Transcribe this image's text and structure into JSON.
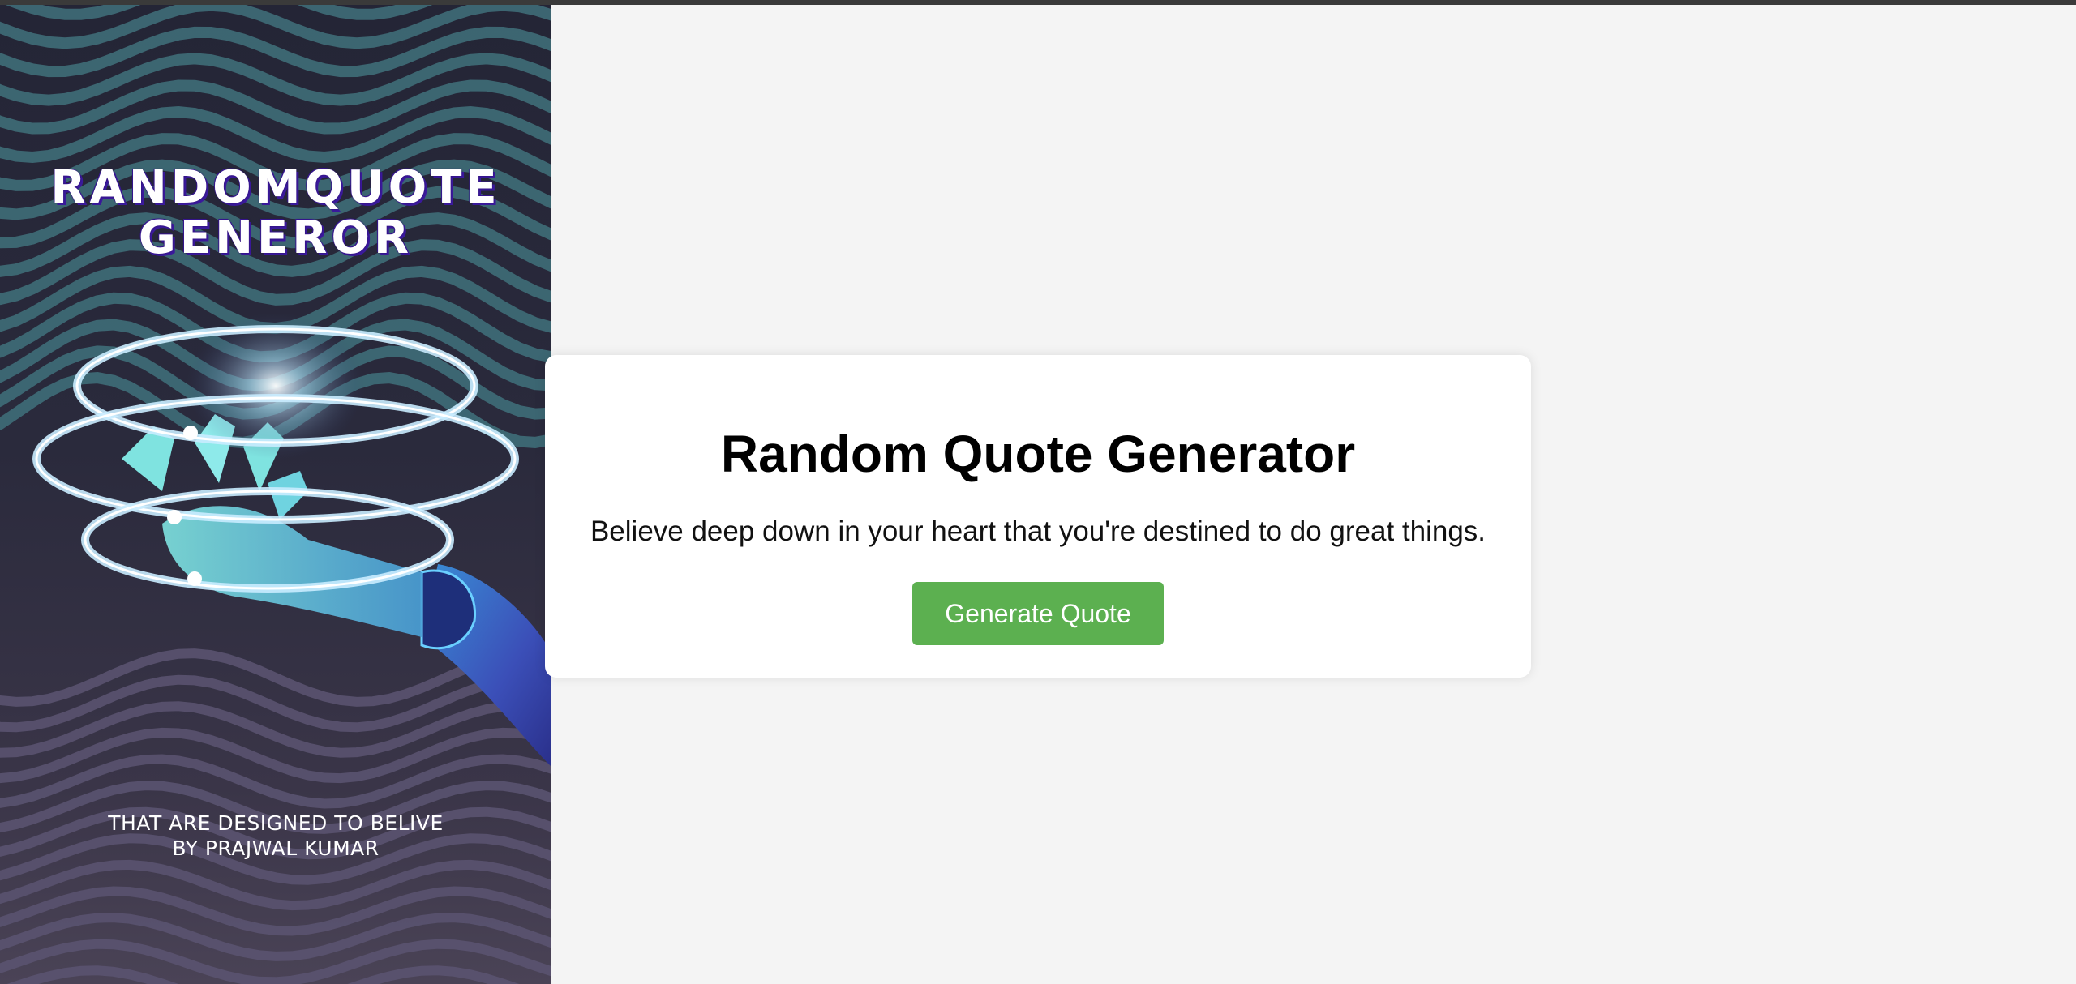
{
  "poster": {
    "title_line1": "RANDOMQUOTE",
    "title_line2": "GENEROR",
    "subtitle_line1": "THAT ARE DESIGNED TO BELIVE",
    "subtitle_line2": "BY PRAJWAL KUMAR",
    "image_subject": "robot-hand-with-glowing-rings"
  },
  "card": {
    "heading": "Random Quote Generator",
    "quote": "Believe deep down in your heart that you're destined to do great things.",
    "button_label": "Generate Quote"
  },
  "colors": {
    "page_background": "#f4f4f4",
    "card_background": "#ffffff",
    "button": "#5cb050",
    "poster_background": "#242536",
    "poster_lines": "#3f6d78"
  }
}
